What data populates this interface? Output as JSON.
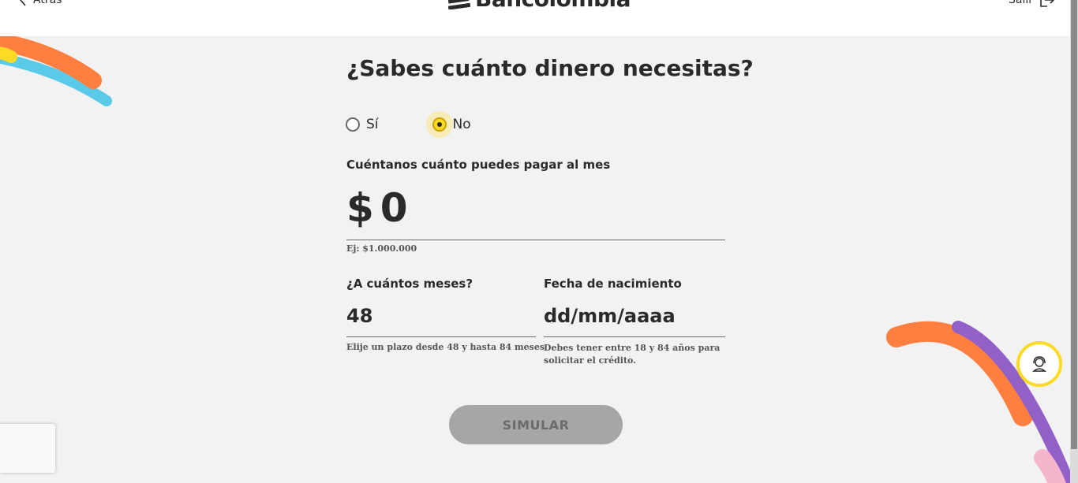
{
  "header": {
    "back_label": "Atrás",
    "logo_text": "Bancolombia",
    "exit_label": "Salir"
  },
  "form": {
    "title": "¿Sabes cuánto dinero necesitas?",
    "radio_yes": "Sí",
    "radio_no": "No",
    "selected": "No",
    "payment_label": "Cuéntanos cuánto puedes pagar al mes",
    "currency_symbol": "$",
    "payment_value": "0",
    "payment_hint": "Ej: $1.000.000",
    "months_label": "¿A cuántos meses?",
    "months_value": "48",
    "months_hint": "Elije un plazo desde 48 y hasta 84 meses",
    "birth_label": "Fecha de nacimiento",
    "birth_placeholder": "dd/mm/aaaa",
    "birth_hint_line1": "Debes tener entre 18 y 84 años para",
    "birth_hint_line2": "solicitar el crédito.",
    "submit_label": "SIMULAR"
  },
  "colors": {
    "accent_yellow": "#fdda24",
    "orange": "#ff7f41",
    "cyan": "#59cbe8",
    "purple": "#9161c8",
    "pink": "#f5b6cd",
    "button_disabled": "#a6a6a6"
  },
  "icons": {
    "back": "chevron-left-icon",
    "logo": "bancolombia-logo-icon",
    "exit": "exit-icon",
    "help": "support-agent-icon"
  }
}
